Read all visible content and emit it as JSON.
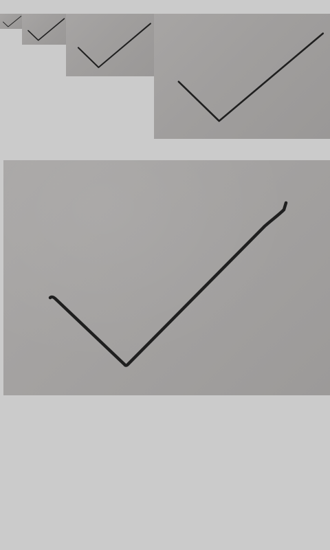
{
  "gallery": {
    "background": "#cbcbcb",
    "thumbnails": [
      {
        "icon": "checkmark-icon",
        "level": 1
      },
      {
        "icon": "checkmark-icon",
        "level": 2
      },
      {
        "icon": "checkmark-icon",
        "level": 3
      },
      {
        "icon": "checkmark-icon",
        "level": 4
      }
    ],
    "preview": {
      "icon": "checkmark-icon"
    },
    "ink_color": "#1f1f1f",
    "paper_color": "#a3a1a0"
  }
}
